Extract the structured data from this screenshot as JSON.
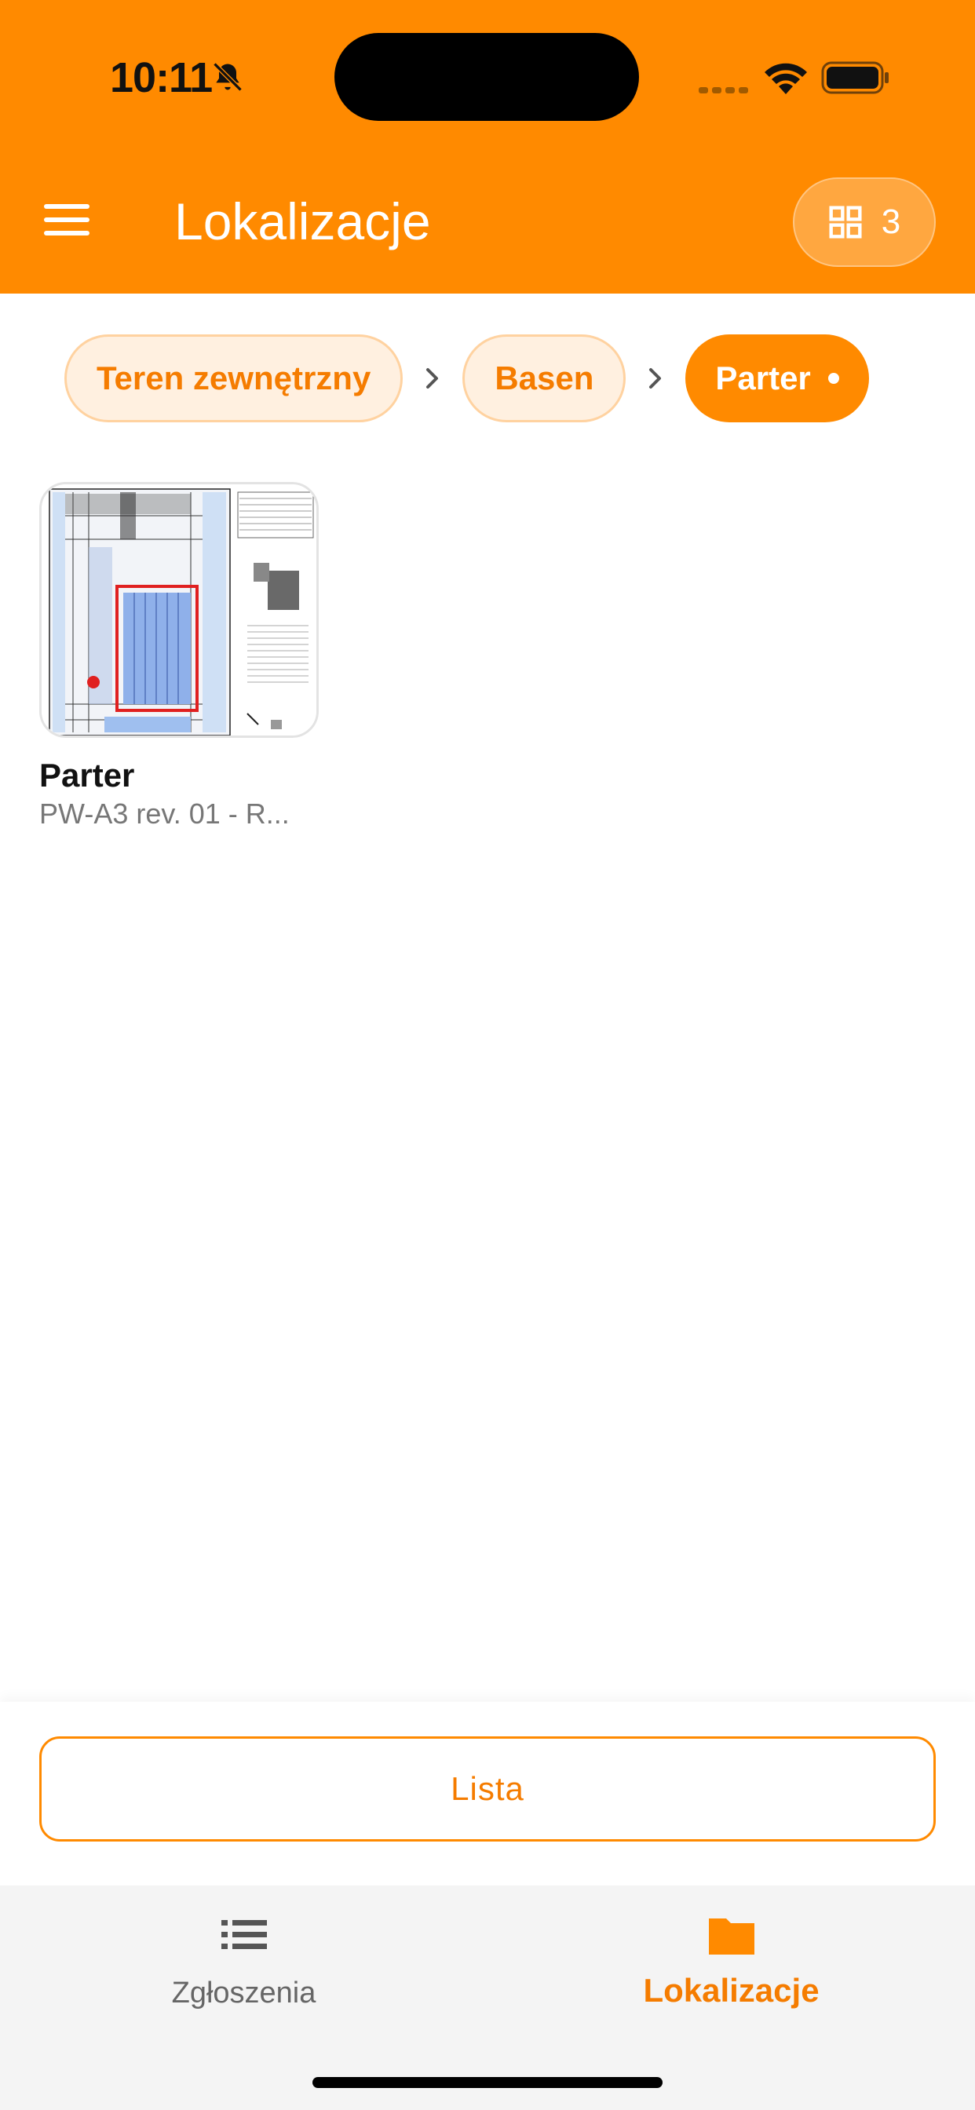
{
  "status_bar": {
    "time": "10:11"
  },
  "header": {
    "title": "Lokalizacje",
    "grid_count": "3"
  },
  "breadcrumbs": [
    {
      "label": "Teren zewnętrzny",
      "active": false
    },
    {
      "label": "Basen",
      "active": false
    },
    {
      "label": "Parter",
      "active": true
    }
  ],
  "plans": [
    {
      "title": "Parter",
      "subtitle": "PW-A3 rev. 01 - R..."
    }
  ],
  "actions": {
    "list_label": "Lista"
  },
  "tabbar": {
    "items": [
      {
        "label": "Zgłoszenia",
        "icon": "list-icon",
        "active": false
      },
      {
        "label": "Lokalizacje",
        "icon": "folder-icon",
        "active": true
      }
    ]
  },
  "colors": {
    "accent": "#FF8A00",
    "accent_text": "#F57C00",
    "chip_bg": "#FFF0E0"
  }
}
